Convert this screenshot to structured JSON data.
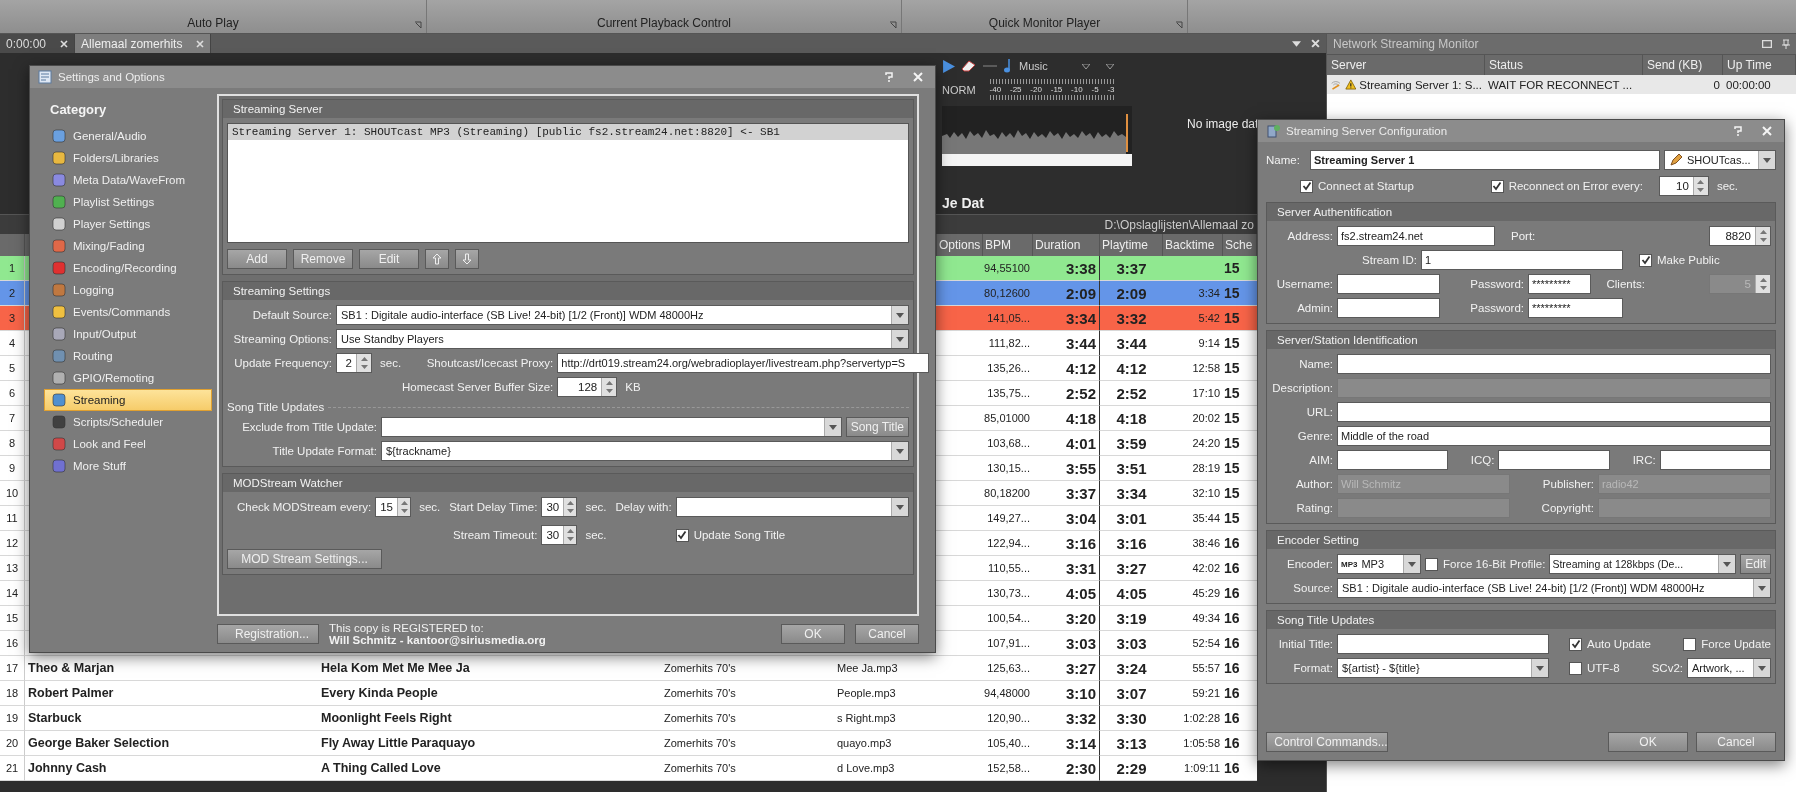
{
  "ribbon": {
    "groups": [
      "Auto Play",
      "Current Playback Control",
      "Quick Monitor Player"
    ]
  },
  "document_tabs": [
    {
      "label": "0:00:00",
      "selected": false
    },
    {
      "label": "Allemaal zomerhits",
      "selected": true
    }
  ],
  "player": {
    "category": "Music",
    "mode": "NORM",
    "meter_ticks": [
      "-40",
      "-25",
      "-20",
      "-15",
      "-10",
      "-5",
      "-3"
    ],
    "image_text": "No image dat",
    "title_fragment": "Je Dat",
    "path": "D:\\Opslaglijsten\\Allemaal zo"
  },
  "playlist": {
    "columns": [
      "Options",
      "BPM",
      "Duration",
      "Playtime",
      "Backtime",
      "Sche"
    ],
    "rows": [
      {
        "number": "1",
        "color": "#90e890",
        "bpm": "94,55100",
        "duration": "3:38",
        "playtime": "3:37",
        "schedule": "15"
      },
      {
        "number": "2",
        "color": "#6495e8",
        "bpm": "80,12600",
        "duration": "2:09",
        "playtime": "2:09",
        "backtime": "3:34",
        "schedule": "15"
      },
      {
        "number": "3",
        "color": "#f86448",
        "bpm": "141,05...",
        "duration": "3:34",
        "playtime": "3:32",
        "backtime": "5:42",
        "schedule": "15"
      },
      {
        "number": "4",
        "bpm": "111,82...",
        "duration": "3:44",
        "playtime": "3:44",
        "backtime": "9:14",
        "schedule": "15"
      },
      {
        "number": "5",
        "bpm": "135,26...",
        "duration": "4:12",
        "playtime": "4:12",
        "backtime": "12:58",
        "schedule": "15"
      },
      {
        "number": "6",
        "bpm": "135,75...",
        "duration": "2:52",
        "playtime": "2:52",
        "backtime": "17:10",
        "schedule": "15"
      },
      {
        "number": "7",
        "bpm": "85,01000",
        "duration": "4:18",
        "playtime": "4:18",
        "backtime": "20:02",
        "schedule": "15"
      },
      {
        "number": "8",
        "bpm": "103,68...",
        "duration": "4:01",
        "playtime": "3:59",
        "backtime": "24:20",
        "schedule": "15"
      },
      {
        "number": "9",
        "bpm": "130,15...",
        "duration": "3:55",
        "playtime": "3:51",
        "backtime": "28:19",
        "schedule": "15"
      },
      {
        "number": "10",
        "bpm": "80,18200",
        "duration": "3:37",
        "playtime": "3:34",
        "backtime": "32:10",
        "schedule": "15"
      },
      {
        "number": "11",
        "bpm": "149,27...",
        "duration": "3:04",
        "playtime": "3:01",
        "backtime": "35:44",
        "schedule": "15"
      },
      {
        "number": "12",
        "bpm": "122,94...",
        "duration": "3:16",
        "playtime": "3:16",
        "backtime": "38:46",
        "schedule": "16"
      },
      {
        "number": "13",
        "bpm": "110,55...",
        "duration": "3:31",
        "playtime": "3:27",
        "backtime": "42:02",
        "schedule": "16"
      },
      {
        "number": "14",
        "bpm": "130,73...",
        "duration": "4:05",
        "playtime": "4:05",
        "backtime": "45:29",
        "schedule": "16"
      },
      {
        "number": "15",
        "bpm": "100,54...",
        "duration": "3:20",
        "playtime": "3:19",
        "backtime": "49:34",
        "schedule": "16"
      },
      {
        "number": "16",
        "bpm": "107,91...",
        "duration": "3:03",
        "playtime": "3:03",
        "backtime": "52:54",
        "schedule": "16"
      },
      {
        "number": "17",
        "artist": "Theo & Marjan",
        "title": "Hela Kom Met Me Mee Ja",
        "album": "Zomerhits 70's",
        "file": "Mee Ja.mp3",
        "bpm": "125,63...",
        "duration": "3:27",
        "playtime": "3:24",
        "backtime": "55:57",
        "schedule": "16"
      },
      {
        "number": "18",
        "artist": "Robert Palmer",
        "title": "Every Kinda People",
        "album": "Zomerhits 70's",
        "file": "People.mp3",
        "bpm": "94,48000",
        "duration": "3:10",
        "playtime": "3:07",
        "backtime": "59:21",
        "schedule": "16"
      },
      {
        "number": "19",
        "artist": "Starbuck",
        "title": "Moonlight Feels Right",
        "album": "Zomerhits 70's",
        "file": "s Right.mp3",
        "bpm": "120,90...",
        "duration": "3:32",
        "playtime": "3:30",
        "backtime": "1:02:28",
        "schedule": "16"
      },
      {
        "number": "20",
        "artist": "George Baker Selection",
        "title": "Fly Away Little Paraquayo",
        "album": "Zomerhits 70's",
        "file": "quayo.mp3",
        "bpm": "105,40...",
        "duration": "3:14",
        "playtime": "3:13",
        "backtime": "1:05:58",
        "schedule": "16"
      },
      {
        "number": "21",
        "artist": "Johnny Cash",
        "title": "A Thing Called Love",
        "album": "Zomerhits 70's",
        "file": "d Love.mp3",
        "bpm": "152,58...",
        "duration": "2:30",
        "playtime": "2:29",
        "backtime": "1:09:11",
        "schedule": "16"
      }
    ]
  },
  "network_monitor": {
    "title": "Network Streaming Monitor",
    "columns": [
      "Server",
      "Status",
      "Send (KB)",
      "Up Time"
    ],
    "rows": [
      {
        "server": "Streaming Server 1: S...",
        "status": "WAIT FOR RECONNECT ...",
        "sent": "0",
        "uptime": "00:00:00"
      }
    ]
  },
  "settings_dialog": {
    "title": "Settings and Options",
    "category_heading": "Category",
    "categories": [
      {
        "label": "General/Audio",
        "selected": false
      },
      {
        "label": "Folders/Libraries",
        "selected": false
      },
      {
        "label": "Meta Data/WaveFrom",
        "selected": false
      },
      {
        "label": "Playlist Settings",
        "selected": false
      },
      {
        "label": "Player Settings",
        "selected": false
      },
      {
        "label": "Mixing/Fading",
        "selected": false
      },
      {
        "label": "Encoding/Recording",
        "selected": false
      },
      {
        "label": "Logging",
        "selected": false
      },
      {
        "label": "Events/Commands",
        "selected": false
      },
      {
        "label": "Input/Output",
        "selected": false
      },
      {
        "label": "Routing",
        "selected": false
      },
      {
        "label": "GPIO/Remoting",
        "selected": false
      },
      {
        "label": "Streaming",
        "selected": true
      },
      {
        "label": "Scripts/Scheduler",
        "selected": false
      },
      {
        "label": "Look and Feel",
        "selected": false
      },
      {
        "label": "More Stuff",
        "selected": false
      }
    ],
    "streaming_server": {
      "heading": "Streaming Server",
      "servers": [
        {
          "label": "Streaming Server 1: SHOUTcast MP3 (Streaming) [public fs2.stream24.net:8820] <- SB1",
          "selected": true
        }
      ],
      "buttons": [
        "Add",
        "Remove",
        "Edit"
      ]
    },
    "streaming_settings": {
      "heading": "Streaming Settings",
      "default_source": {
        "label": "Default Source:",
        "value": "SB1 : Digitale audio-interface (SB Live! 24-bit) [1/2 (Front)] WDM 48000Hz"
      },
      "streaming_options": {
        "label": "Streaming Options:",
        "value": "Use Standby Players"
      },
      "update_frequency": {
        "label": "Update Frequency:",
        "value": "2",
        "unit": "sec."
      },
      "proxy": {
        "label": "Shoutcast/Icecast Proxy:",
        "value": "http://drt019.stream24.org/webradioplayer/livestream.php?servertyp=S"
      },
      "buffer": {
        "label": "Homecast Server Buffer Size:",
        "value": "128",
        "unit": "KB"
      }
    },
    "song_title_updates": {
      "heading": "Song Title Updates",
      "exclude": {
        "label": "Exclude from Title Update:",
        "button": "Song Title"
      },
      "format": {
        "label": "Title Update Format:",
        "value": "${trackname}"
      }
    },
    "modstream_watcher": {
      "heading": "MODStream Watcher",
      "check_every": {
        "label": "Check MODStream every:",
        "value": "15",
        "unit": "sec."
      },
      "start_delay": {
        "label": "Start Delay Time:",
        "value": "30",
        "unit": "sec."
      },
      "delay_with": {
        "label": "Delay with:"
      },
      "stream_timeout": {
        "label": "Stream Timeout:",
        "value": "30",
        "unit": "sec."
      },
      "update_song_title": {
        "label": "Update Song Title",
        "checked": true
      },
      "settings_button": "MOD Stream Settings..."
    },
    "footer": {
      "registration_button": "Registration...",
      "registered_line": "This copy is REGISTERED to:",
      "registered_to": "Will Schmitz - kantoor@siriusmedia.org",
      "buttons": [
        "OK",
        "Cancel"
      ]
    }
  },
  "server_config": {
    "title": "Streaming Server Configuration",
    "name": {
      "label": "Name:",
      "value": "Streaming Server 1"
    },
    "server_type": "SHOUTcas...",
    "connect_at_startup": {
      "label": "Connect at Startup",
      "checked": true
    },
    "reconnect": {
      "label": "Reconnect on Error every:",
      "checked": true,
      "value": "10",
      "unit": "sec."
    },
    "authentication": {
      "heading": "Server Authentification",
      "address": {
        "label": "Address:",
        "value": "fs2.stream24.net"
      },
      "port": {
        "label": "Port:",
        "value": "8820"
      },
      "stream_id": {
        "label": "Stream ID:",
        "value": "1"
      },
      "make_public": {
        "label": "Make Public",
        "checked": true
      },
      "username": {
        "label": "Username:"
      },
      "password": {
        "label": "Password:",
        "value": "*********"
      },
      "clients": {
        "label": "Clients:",
        "value": "5",
        "disabled": true
      },
      "admin": {
        "label": "Admin:"
      },
      "admin_password": {
        "label": "Password:",
        "value": "*********"
      }
    },
    "identification": {
      "heading": "Server/Station Identification",
      "name": {
        "label": "Name:",
        "disabled": false
      },
      "description": {
        "label": "Description:",
        "disabled": true
      },
      "url": {
        "label": "URL:",
        "disabled": false
      },
      "genre": {
        "label": "Genre:",
        "value": "Middle of the road",
        "disabled": false
      },
      "aim": {
        "label": "AIM:",
        "disabled": false
      },
      "icq": {
        "label": "ICQ:",
        "disabled": false
      },
      "irc": {
        "label": "IRC:",
        "disabled": false
      },
      "author": {
        "label": "Author:",
        "value": "Will Schmitz",
        "disabled": true
      },
      "publisher": {
        "label": "Publisher:",
        "value": "radio42",
        "disabled": true
      },
      "rating": {
        "label": "Rating:",
        "disabled": true
      },
      "copyright": {
        "label": "Copyright:",
        "disabled": true
      }
    },
    "encoder": {
      "heading": "Encoder Setting",
      "encoder": {
        "label": "Encoder:",
        "badge": "MP3",
        "value": "MP3"
      },
      "force_16bit": {
        "label": "Force 16-Bit",
        "checked": false
      },
      "profile": {
        "label": "Profile:",
        "value": "Streaming at 128kbps (De...",
        "button": "Edit"
      },
      "source": {
        "label": "Source:",
        "value": "SB1 : Digitale audio-interface (SB Live! 24-bit) [1/2 (Front)] WDM 48000Hz"
      }
    },
    "song_titles": {
      "heading": "Song Title Updates",
      "initial_title": {
        "label": "Initial Title:"
      },
      "auto_update": {
        "label": "Auto Update",
        "checked": true
      },
      "force_update": {
        "label": "Force Update",
        "checked": false
      },
      "format": {
        "label": "Format:",
        "value": "${artist} - ${title}"
      },
      "utf8": {
        "label": "UTF-8",
        "checked": false
      },
      "scv2": {
        "label": "SCv2:",
        "value": "Artwork, ..."
      }
    },
    "buttons": {
      "control_commands": "Control Commands...",
      "ok": "OK",
      "cancel": "Cancel"
    }
  }
}
